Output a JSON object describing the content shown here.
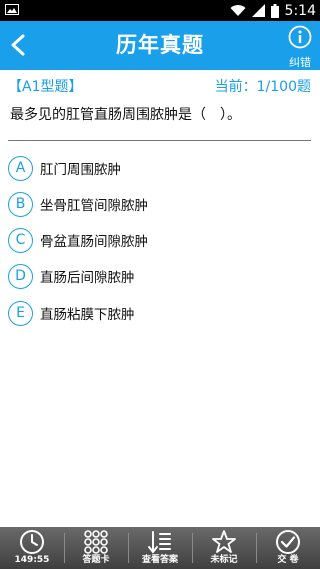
{
  "status_bar": {
    "time": "5:14"
  },
  "header": {
    "title": "历年真题",
    "report_label": "纠错"
  },
  "question_meta": {
    "type": "【A1型题】",
    "progress": "当前：1/100题"
  },
  "question": {
    "text": "最多见的肛管直肠周围脓肿是（　）。"
  },
  "options": [
    {
      "letter": "A",
      "text": "肛门周围脓肿"
    },
    {
      "letter": "B",
      "text": "坐骨肛管间隙脓肿"
    },
    {
      "letter": "C",
      "text": "骨盆直肠间隙脓肿"
    },
    {
      "letter": "D",
      "text": "直肠后间隙脓肿"
    },
    {
      "letter": "E",
      "text": "直肠粘膜下脓肿"
    }
  ],
  "bottom_bar": {
    "timer": "149:55",
    "answer_sheet": "答题卡",
    "view_answer": "查看答案",
    "unmarked": "未标记",
    "submit": "交 卷"
  },
  "colors": {
    "accent": "#1aa0ea",
    "status_bar": "#000000",
    "bottom_bar": "#4f4f4f"
  }
}
